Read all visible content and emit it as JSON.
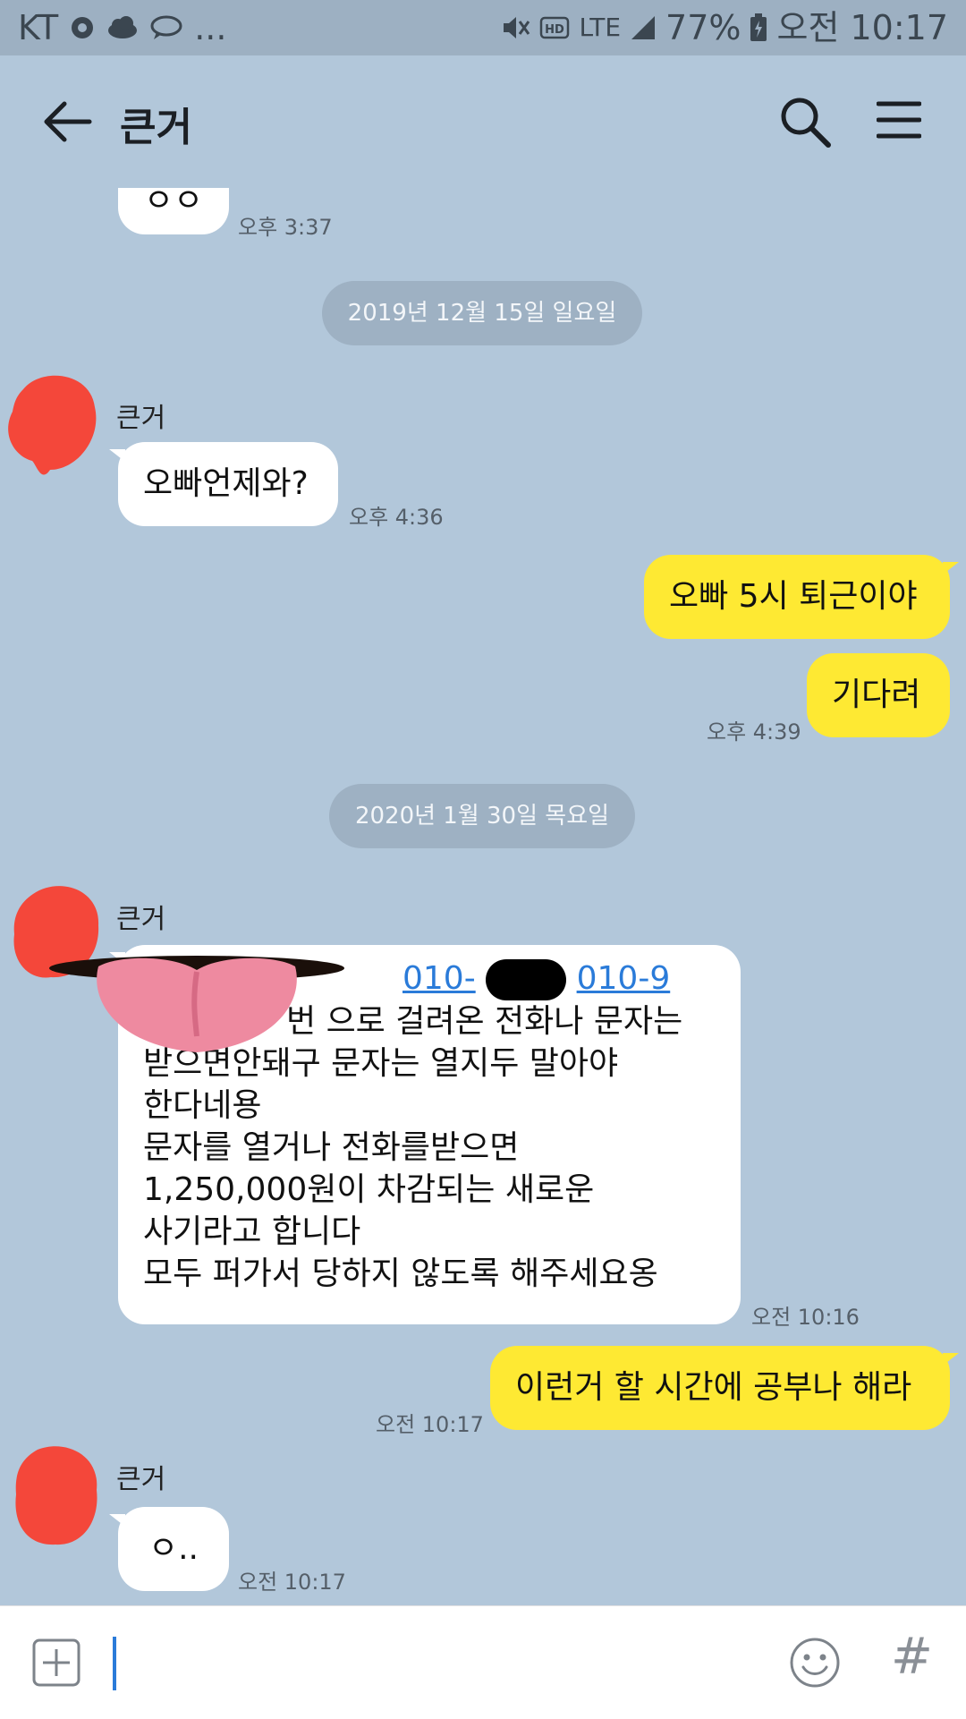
{
  "status_bar": {
    "carrier": "KT",
    "dots": "...",
    "lte": "LTE",
    "battery_percent": "77%",
    "time": "오전 10:17"
  },
  "header": {
    "title": "큰거"
  },
  "messages": {
    "m0": {
      "time": "오후 3:37",
      "text": "ㅇㅇ"
    },
    "date1": "2019년 12월 15일 일요일",
    "sender1": "큰거",
    "m1": {
      "text": "오빠언제와?",
      "time": "오후 4:36"
    },
    "m2": {
      "text": "오빠 5시 퇴근이야"
    },
    "m3": {
      "text": "기다려",
      "time": "오후 4:39"
    },
    "date2": "2020년 1월 30일 목요일",
    "sender2": "큰거",
    "m4": {
      "link1": "010-",
      "link2": "010-9",
      "line1_rest": "번 으로 걸려온 전화나 문자는",
      "line2": "받으면안돼구 문자는 열지두 말아야",
      "line3": "한다네용",
      "line4": "문자를 열거나 전화를받으면",
      "line5": "1,250,000원이 차감되는 새로운",
      "line6": "사기라고 합니다",
      "line7": "모두 퍼가서 당하지 않도록 해주세요옹",
      "time": "오전 10:16"
    },
    "m5": {
      "text": "이런거 할 시간에 공부나 해라",
      "time": "오전 10:17"
    },
    "sender3": "큰거",
    "m6": {
      "text": "ㅇ..",
      "time": "오전 10:17"
    }
  },
  "input": {
    "placeholder": ""
  },
  "colors": {
    "background": "#b2c7da",
    "my_bubble": "#fee933",
    "their_bubble": "#ffffff",
    "link": "#2a7bd9"
  }
}
